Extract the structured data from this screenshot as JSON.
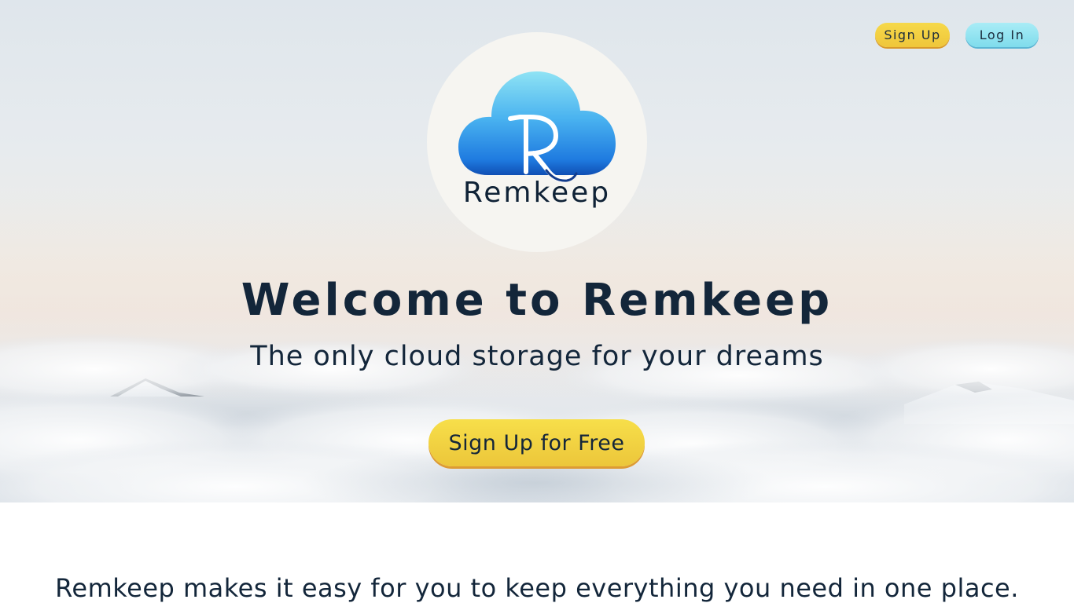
{
  "nav": {
    "signup_label": "Sign Up",
    "login_label": "Log In"
  },
  "logo": {
    "text": "Remkeep",
    "icon": "cloud-logo-icon"
  },
  "hero": {
    "title": "Welcome to Remkeep",
    "subtitle": "The only cloud storage for your dreams",
    "cta_label": "Sign Up for Free"
  },
  "intro": {
    "text": "Remkeep makes it easy for you to keep everything you need in one place."
  },
  "colors": {
    "signup_button": "#f2cf42",
    "login_button": "#93e4f1",
    "cta_button": "#f2d240",
    "text": "#13263a",
    "logo_circle": "#f6f5f1"
  }
}
